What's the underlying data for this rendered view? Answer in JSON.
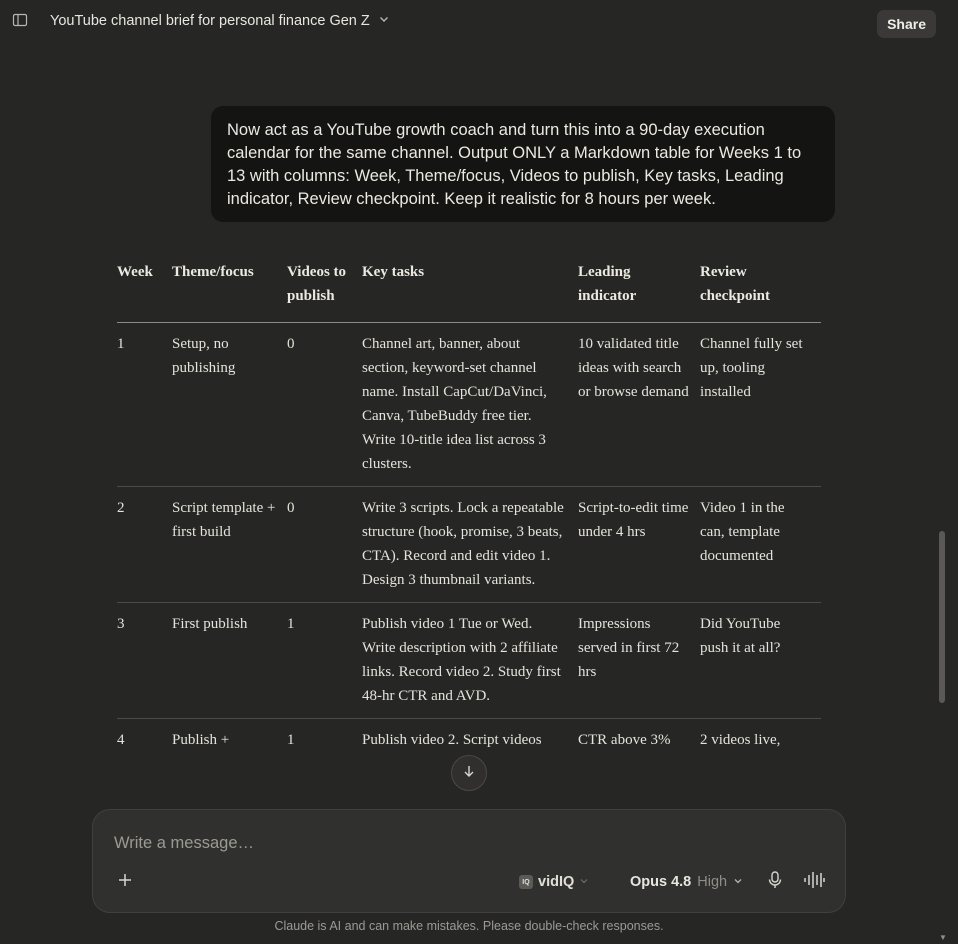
{
  "header": {
    "title": "YouTube channel brief for personal finance Gen Z",
    "share_label": "Share"
  },
  "user_message": "Now act as a YouTube growth coach and turn this into a 90-day execution calendar for the same channel. Output ONLY a Markdown table for Weeks 1 to 13 with columns: Week, Theme/focus, Videos to publish, Key tasks, Leading indicator, Review checkpoint. Keep it realistic for 8 hours per week.",
  "table": {
    "headers": [
      "Week",
      "Theme/focus",
      "Videos to publish",
      "Key tasks",
      "Leading indicator",
      "Review checkpoint"
    ],
    "rows": [
      [
        "1",
        "Setup, no publishing",
        "0",
        "Channel art, banner, about section, keyword-set channel name. Install CapCut/DaVinci, Canva, TubeBuddy free tier. Write 10-title idea list across 3 clusters.",
        "10 validated title ideas with search or browse demand",
        "Channel fully set up, tooling installed"
      ],
      [
        "2",
        "Script template + first build",
        "0",
        "Write 3 scripts. Lock a repeatable structure (hook, promise, 3 beats, CTA). Record and edit video 1. Design 3 thumbnail variants.",
        "Script-to-edit time under 4 hrs",
        "Video 1 in the can, template documented"
      ],
      [
        "3",
        "First publish",
        "1",
        "Publish video 1 Tue or Wed. Write description with 2 affiliate links. Record video 2. Study first 48-hr CTR and AVD.",
        "Impressions served in first 72 hrs",
        "Did YouTube push it at all?"
      ],
      [
        "4",
        "Publish +",
        "1",
        "Publish video 2. Script videos",
        "CTR above 3%",
        "2 videos live,"
      ]
    ]
  },
  "composer": {
    "placeholder": "Write a message…",
    "tool_label": "vidIQ",
    "tool_logo_text": "IQ",
    "model_name": "Opus 4.8",
    "effort": "High"
  },
  "disclaimer": "Claude is AI and can make mistakes. Please double-check responses.",
  "icons": [
    "sidebar-toggle-icon",
    "chevron-down-icon",
    "arrow-down-icon",
    "plus-icon",
    "microphone-icon",
    "voice-waveform-icon"
  ]
}
